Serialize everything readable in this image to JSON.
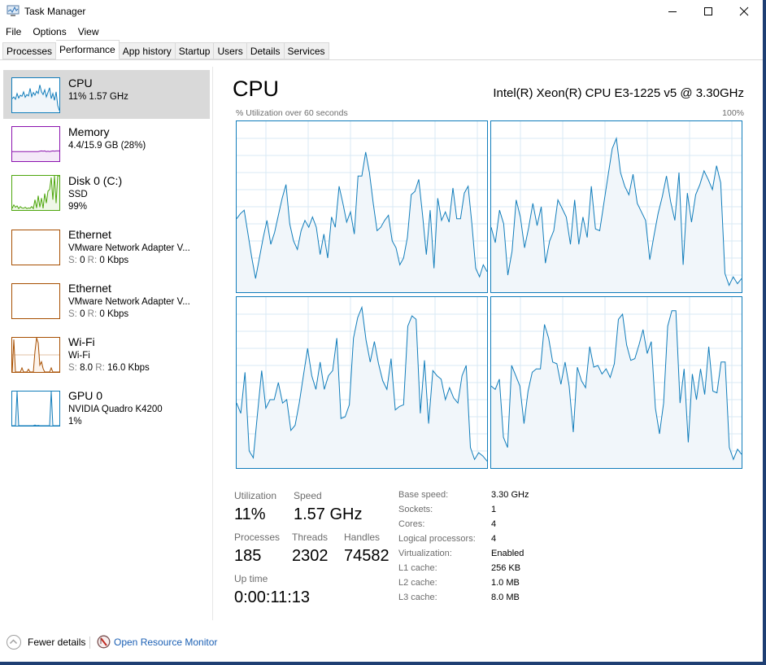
{
  "window": {
    "title": "Task Manager",
    "controls": {
      "minimize": "minimize",
      "maximize": "maximize",
      "close": "close"
    }
  },
  "menu": [
    "File",
    "Options",
    "View"
  ],
  "tabs": [
    {
      "label": "Processes",
      "active": false
    },
    {
      "label": "Performance",
      "active": true
    },
    {
      "label": "App history",
      "active": false
    },
    {
      "label": "Startup",
      "active": false
    },
    {
      "label": "Users",
      "active": false
    },
    {
      "label": "Details",
      "active": false
    },
    {
      "label": "Services",
      "active": false
    }
  ],
  "sidebar": {
    "items": [
      {
        "name": "CPU",
        "line1": "11% 1.57 GHz",
        "color": "#117dbb",
        "fill": "#f1f6fa",
        "selected": true,
        "spark": [
          40,
          45,
          38,
          55,
          42,
          50,
          47,
          60,
          44,
          52,
          48,
          70,
          46,
          58,
          50,
          62,
          55,
          80,
          60,
          52,
          66,
          45,
          58,
          72,
          40,
          55,
          35,
          60,
          20,
          5
        ]
      },
      {
        "name": "Memory",
        "line1": "4.4/15.9 GB (28%)",
        "color": "#8b12ae",
        "fill": "#f4e8f8",
        "selected": false,
        "spark": [
          28,
          28,
          28,
          28,
          28,
          28,
          28,
          28,
          28,
          28,
          28,
          28,
          28,
          28,
          28,
          28,
          28,
          29,
          30,
          29,
          30,
          28,
          29,
          28,
          29,
          30,
          29,
          30,
          30,
          30
        ]
      },
      {
        "name": "Disk 0 (C:)",
        "line1": "SSD",
        "line2": "99%",
        "color": "#4da60c",
        "fill": "#eff7e8",
        "selected": false,
        "spark": [
          5,
          15,
          8,
          12,
          4,
          10,
          6,
          5,
          8,
          4,
          6,
          5,
          10,
          4,
          30,
          6,
          42,
          8,
          35,
          5,
          48,
          20,
          55,
          60,
          95,
          30,
          100,
          20,
          100,
          100
        ]
      },
      {
        "name": "Ethernet",
        "line1": "VMware Network Adapter V...",
        "line2_s": "0",
        "line2_r": "0 Kbps",
        "color": "#a74f01",
        "fill": "#fcf3eb",
        "selected": false,
        "spark": []
      },
      {
        "name": "Ethernet",
        "line1": "VMware Network Adapter V...",
        "line2_s": "0",
        "line2_r": "0 Kbps",
        "color": "#a74f01",
        "fill": "#fcf3eb",
        "selected": false,
        "spark": []
      },
      {
        "name": "Wi-Fi",
        "line1": "Wi-Fi",
        "line2_s": "8.0",
        "line2_r": "16.0 Kbps",
        "color": "#a74f01",
        "fill": "#fcf3eb",
        "selected": false,
        "spark": [
          0,
          95,
          0,
          0,
          0,
          0,
          12,
          0,
          0,
          0,
          8,
          0,
          0,
          0,
          60,
          100,
          85,
          20,
          30,
          10,
          0,
          0,
          0,
          0,
          12,
          0,
          0,
          0,
          0,
          0
        ]
      },
      {
        "name": "GPU 0",
        "line1": "NVIDIA Quadro K4200",
        "line2": "1%",
        "color": "#117dbb",
        "fill": "#f1f6fa",
        "selected": false,
        "spark": [
          0,
          0,
          0,
          100,
          0,
          0,
          0,
          0,
          0,
          0,
          0,
          0,
          0,
          0,
          2,
          0,
          1,
          0,
          0,
          0,
          0,
          0,
          0,
          0,
          100,
          0,
          0,
          0,
          0,
          0
        ]
      }
    ]
  },
  "main": {
    "title": "CPU",
    "model": "Intel(R) Xeon(R) CPU E3-1225 v5 @ 3.30GHz",
    "axis_left": "% Utilization over 60 seconds",
    "axis_right": "100%",
    "stats": {
      "utilization_label": "Utilization",
      "utilization": "11%",
      "speed_label": "Speed",
      "speed": "1.57 GHz",
      "processes_label": "Processes",
      "processes": "185",
      "threads_label": "Threads",
      "threads": "2302",
      "handles_label": "Handles",
      "handles": "74582",
      "uptime_label": "Up time",
      "uptime": "0:00:11:13"
    },
    "specs": [
      {
        "label": "Base speed:",
        "value": "3.30 GHz"
      },
      {
        "label": "Sockets:",
        "value": "1"
      },
      {
        "label": "Cores:",
        "value": "4"
      },
      {
        "label": "Logical processors:",
        "value": "4"
      },
      {
        "label": "Virtualization:",
        "value": "Enabled"
      },
      {
        "label": "L1 cache:",
        "value": "256 KB"
      },
      {
        "label": "L2 cache:",
        "value": "1.0 MB"
      },
      {
        "label": "L3 cache:",
        "value": "8.0 MB"
      }
    ]
  },
  "chart_data": {
    "type": "line",
    "title": "CPU",
    "xlabel": "% Utilization over 60 seconds",
    "ylabel": "",
    "ylim": [
      0,
      100
    ],
    "xlim": [
      60,
      0
    ],
    "grid": true,
    "color": "#117dbb",
    "fill": "#f1f6fa",
    "series": [
      {
        "name": "Logical processor 0",
        "values": [
          43,
          46,
          48,
          34,
          20,
          8,
          20,
          32,
          42,
          28,
          35,
          45,
          55,
          63,
          40,
          30,
          25,
          36,
          42,
          38,
          44,
          38,
          22,
          34,
          20,
          44,
          38,
          62,
          52,
          41,
          47,
          34,
          68,
          68,
          82,
          70,
          52,
          36,
          38,
          42,
          45,
          30,
          26,
          16,
          20,
          32,
          57,
          59,
          66,
          45,
          22,
          48,
          14,
          55,
          42,
          47,
          41,
          61,
          43,
          43,
          58,
          62,
          40,
          14,
          9,
          16,
          12
        ]
      },
      {
        "name": "Logical processor 1",
        "values": [
          38,
          29,
          48,
          40,
          10,
          24,
          54,
          44,
          26,
          38,
          52,
          39,
          50,
          17,
          30,
          36,
          54,
          49,
          44,
          28,
          54,
          28,
          44,
          32,
          62,
          37,
          36,
          52,
          68,
          84,
          90,
          70,
          62,
          57,
          69,
          52,
          47,
          42,
          19,
          33,
          46,
          56,
          68,
          53,
          42,
          70,
          16,
          58,
          41,
          57,
          63,
          71,
          66,
          60,
          74,
          64,
          11,
          4,
          9,
          5,
          8
        ]
      },
      {
        "name": "Logical processor 2",
        "values": [
          38,
          32,
          56,
          10,
          6,
          32,
          57,
          35,
          40,
          40,
          50,
          38,
          40,
          22,
          25,
          38,
          54,
          70,
          54,
          46,
          62,
          46,
          54,
          57,
          76,
          29,
          30,
          37,
          76,
          88,
          94,
          75,
          62,
          74,
          61,
          51,
          46,
          64,
          34,
          36,
          37,
          83,
          89,
          87,
          32,
          63,
          26,
          57,
          54,
          52,
          40,
          47,
          41,
          38,
          54,
          60,
          12,
          5,
          9,
          7,
          4
        ]
      },
      {
        "name": "Logical processor 3",
        "values": [
          48,
          46,
          52,
          18,
          12,
          60,
          54,
          48,
          26,
          45,
          56,
          58,
          58,
          84,
          76,
          62,
          61,
          49,
          62,
          48,
          21,
          59,
          51,
          47,
          71,
          59,
          60,
          55,
          58,
          53,
          61,
          87,
          90,
          72,
          63,
          64,
          72,
          81,
          67,
          74,
          35,
          20,
          38,
          83,
          92,
          92,
          38,
          58,
          15,
          55,
          40,
          58,
          43,
          71,
          45,
          44,
          62,
          62,
          12,
          5,
          11,
          8
        ]
      }
    ]
  },
  "footer": {
    "fewer_details": "Fewer details",
    "open_resource_monitor": "Open Resource Monitor"
  }
}
